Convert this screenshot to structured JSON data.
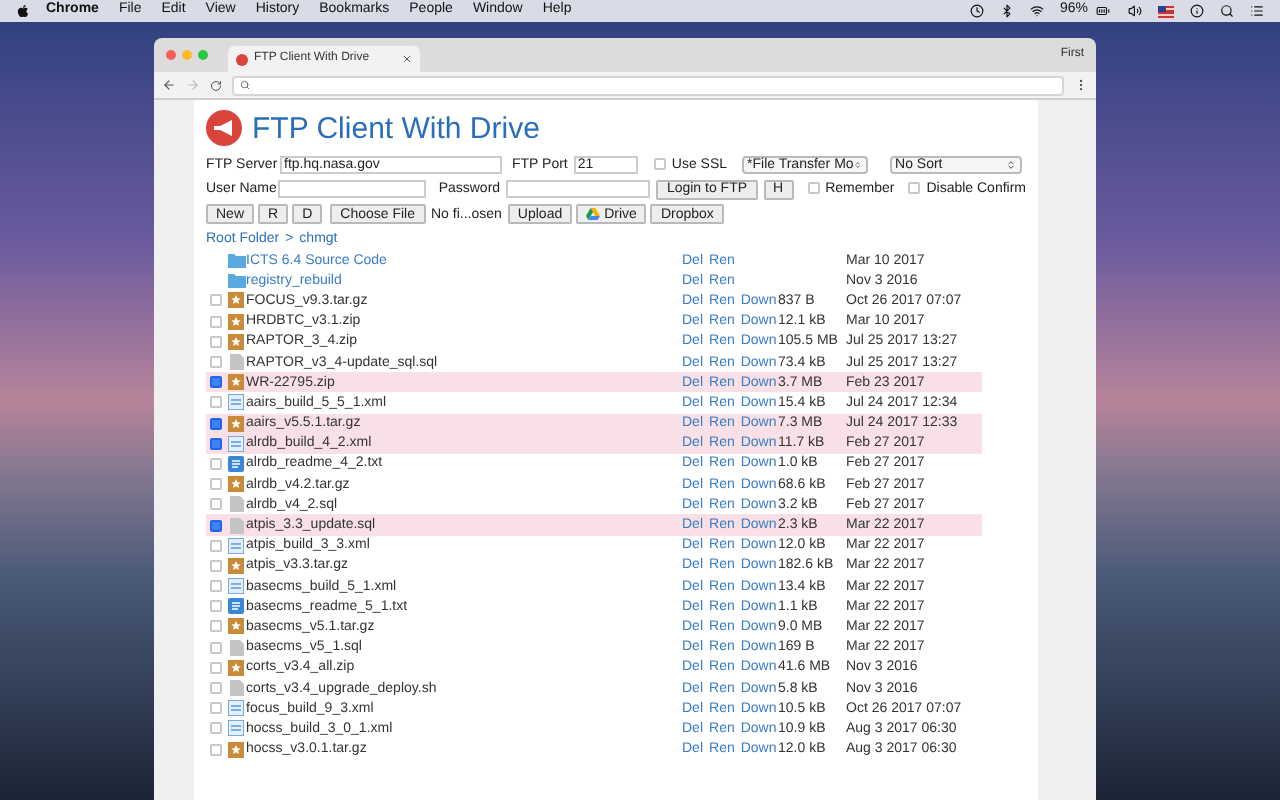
{
  "menubar": {
    "app": "Chrome",
    "items": [
      "File",
      "Edit",
      "View",
      "History",
      "Bookmarks",
      "People",
      "Window",
      "Help"
    ],
    "battery": "96%"
  },
  "browser": {
    "tab_title": "FTP Client With Drive",
    "profile": "First"
  },
  "page": {
    "title": "FTP Client With Drive",
    "server": {
      "label": "FTP Server",
      "value": "ftp.hq.nasa.gov"
    },
    "port": {
      "label": "FTP Port",
      "value": "21"
    },
    "ssl": {
      "label": "Use SSL",
      "checked": false
    },
    "mode_select": {
      "value": "*File Transfer Mo"
    },
    "sort_select": {
      "value": "No Sort"
    },
    "user": {
      "label": "User Name"
    },
    "password": {
      "label": "Password"
    },
    "login_button": "Login to FTP",
    "h_button": "H",
    "remember": {
      "label": "Remember",
      "checked": false
    },
    "disable_confirm": {
      "label": "Disable Confirm",
      "checked": false
    },
    "toolbar": [
      "New",
      "R",
      "D"
    ],
    "choose_file": "Choose File",
    "file_status": "No fi...osen",
    "upload": "Upload",
    "drive": "Drive",
    "dropbox": "Dropbox",
    "breadcrumb": {
      "root": "Root Folder",
      "separator": ">",
      "current": "chmgt"
    }
  },
  "entries": [
    {
      "kind": "folder",
      "name": "ICTS 6.4 Source Code",
      "actions": [
        "Del",
        "Ren"
      ],
      "date": "Mar 10 2017"
    },
    {
      "kind": "folder",
      "name": "registry_rebuild",
      "actions": [
        "Del",
        "Ren"
      ],
      "date": "Nov 3 2016"
    },
    {
      "kind": "archive",
      "name": "FOCUS_v9.3.tar.gz",
      "actions": [
        "Del",
        "Ren",
        "Down"
      ],
      "size": "837 B",
      "date": "Oct 26 2017 07:07",
      "checked": false
    },
    {
      "kind": "archive",
      "name": "HRDBTC_v3.1.zip",
      "actions": [
        "Del",
        "Ren",
        "Down"
      ],
      "size": "12.1 kB",
      "date": "Mar 10 2017",
      "checked": false
    },
    {
      "kind": "archive",
      "name": "RAPTOR_3_4.zip",
      "actions": [
        "Del",
        "Ren",
        "Down"
      ],
      "size": "105.5 MB",
      "date": "Jul 25 2017 13:27",
      "checked": false
    },
    {
      "kind": "doc",
      "name": "RAPTOR_v3_4-update_sql.sql",
      "actions": [
        "Del",
        "Ren",
        "Down"
      ],
      "size": "73.4 kB",
      "date": "Jul 25 2017 13:27",
      "checked": false
    },
    {
      "kind": "archive",
      "name": "WR-22795.zip",
      "actions": [
        "Del",
        "Ren",
        "Down"
      ],
      "size": "3.7 MB",
      "date": "Feb 23 2017",
      "checked": true
    },
    {
      "kind": "xml",
      "name": "aairs_build_5_5_1.xml",
      "actions": [
        "Del",
        "Ren",
        "Down"
      ],
      "size": "15.4 kB",
      "date": "Jul 24 2017 12:34",
      "checked": false
    },
    {
      "kind": "archive",
      "name": "aairs_v5.5.1.tar.gz",
      "actions": [
        "Del",
        "Ren",
        "Down"
      ],
      "size": "7.3 MB",
      "date": "Jul 24 2017 12:33",
      "checked": true
    },
    {
      "kind": "xml",
      "name": "alrdb_build_4_2.xml",
      "actions": [
        "Del",
        "Ren",
        "Down"
      ],
      "size": "11.7 kB",
      "date": "Feb 27 2017",
      "checked": true
    },
    {
      "kind": "txt",
      "name": "alrdb_readme_4_2.txt",
      "actions": [
        "Del",
        "Ren",
        "Down"
      ],
      "size": "1.0 kB",
      "date": "Feb 27 2017",
      "checked": false
    },
    {
      "kind": "archive",
      "name": "alrdb_v4.2.tar.gz",
      "actions": [
        "Del",
        "Ren",
        "Down"
      ],
      "size": "68.6 kB",
      "date": "Feb 27 2017",
      "checked": false
    },
    {
      "kind": "doc",
      "name": "alrdb_v4_2.sql",
      "actions": [
        "Del",
        "Ren",
        "Down"
      ],
      "size": "3.2 kB",
      "date": "Feb 27 2017",
      "checked": false
    },
    {
      "kind": "doc",
      "name": "atpis_3.3_update.sql",
      "actions": [
        "Del",
        "Ren",
        "Down"
      ],
      "size": "2.3 kB",
      "date": "Mar 22 2017",
      "checked": true
    },
    {
      "kind": "xml",
      "name": "atpis_build_3_3.xml",
      "actions": [
        "Del",
        "Ren",
        "Down"
      ],
      "size": "12.0 kB",
      "date": "Mar 22 2017",
      "checked": false
    },
    {
      "kind": "archive",
      "name": "atpis_v3.3.tar.gz",
      "actions": [
        "Del",
        "Ren",
        "Down"
      ],
      "size": "182.6 kB",
      "date": "Mar 22 2017",
      "checked": false
    },
    {
      "kind": "xml",
      "name": "basecms_build_5_1.xml",
      "actions": [
        "Del",
        "Ren",
        "Down"
      ],
      "size": "13.4 kB",
      "date": "Mar 22 2017",
      "checked": false
    },
    {
      "kind": "txt",
      "name": "basecms_readme_5_1.txt",
      "actions": [
        "Del",
        "Ren",
        "Down"
      ],
      "size": "1.1 kB",
      "date": "Mar 22 2017",
      "checked": false
    },
    {
      "kind": "archive",
      "name": "basecms_v5.1.tar.gz",
      "actions": [
        "Del",
        "Ren",
        "Down"
      ],
      "size": "9.0 MB",
      "date": "Mar 22 2017",
      "checked": false
    },
    {
      "kind": "doc",
      "name": "basecms_v5_1.sql",
      "actions": [
        "Del",
        "Ren",
        "Down"
      ],
      "size": "169 B",
      "date": "Mar 22 2017",
      "checked": false
    },
    {
      "kind": "archive",
      "name": "corts_v3.4_all.zip",
      "actions": [
        "Del",
        "Ren",
        "Down"
      ],
      "size": "41.6 MB",
      "date": "Nov 3 2016",
      "checked": false
    },
    {
      "kind": "doc",
      "name": "corts_v3.4_upgrade_deploy.sh",
      "actions": [
        "Del",
        "Ren",
        "Down"
      ],
      "size": "5.8 kB",
      "date": "Nov 3 2016",
      "checked": false
    },
    {
      "kind": "xml",
      "name": "focus_build_9_3.xml",
      "actions": [
        "Del",
        "Ren",
        "Down"
      ],
      "size": "10.5 kB",
      "date": "Oct 26 2017 07:07",
      "checked": false
    },
    {
      "kind": "xml",
      "name": "hocss_build_3_0_1.xml",
      "actions": [
        "Del",
        "Ren",
        "Down"
      ],
      "size": "10.9 kB",
      "date": "Aug 3 2017 06:30",
      "checked": false
    },
    {
      "kind": "archive",
      "name": "hocss_v3.0.1.tar.gz",
      "actions": [
        "Del",
        "Ren",
        "Down"
      ],
      "size": "12.0 kB",
      "date": "Aug 3 2017 06:30",
      "checked": false
    }
  ]
}
